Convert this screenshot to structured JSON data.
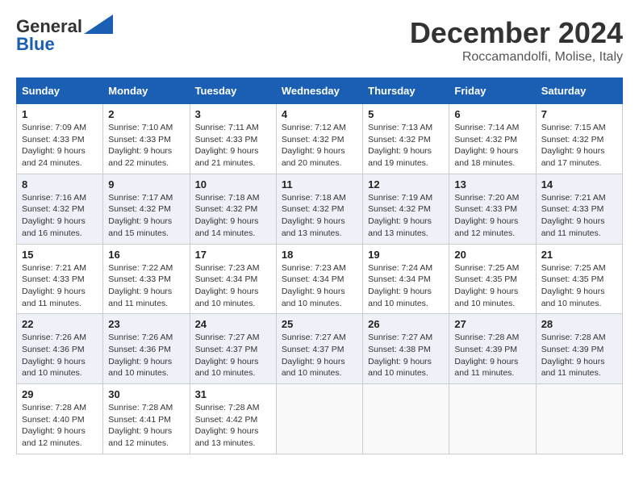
{
  "logo": {
    "line1": "General",
    "line2": "Blue"
  },
  "title": "December 2024",
  "location": "Roccamandolfi, Molise, Italy",
  "days_of_week": [
    "Sunday",
    "Monday",
    "Tuesday",
    "Wednesday",
    "Thursday",
    "Friday",
    "Saturday"
  ],
  "weeks": [
    [
      {
        "day": "1",
        "sunrise": "7:09 AM",
        "sunset": "4:33 PM",
        "daylight": "9 hours and 24 minutes."
      },
      {
        "day": "2",
        "sunrise": "7:10 AM",
        "sunset": "4:33 PM",
        "daylight": "9 hours and 22 minutes."
      },
      {
        "day": "3",
        "sunrise": "7:11 AM",
        "sunset": "4:33 PM",
        "daylight": "9 hours and 21 minutes."
      },
      {
        "day": "4",
        "sunrise": "7:12 AM",
        "sunset": "4:32 PM",
        "daylight": "9 hours and 20 minutes."
      },
      {
        "day": "5",
        "sunrise": "7:13 AM",
        "sunset": "4:32 PM",
        "daylight": "9 hours and 19 minutes."
      },
      {
        "day": "6",
        "sunrise": "7:14 AM",
        "sunset": "4:32 PM",
        "daylight": "9 hours and 18 minutes."
      },
      {
        "day": "7",
        "sunrise": "7:15 AM",
        "sunset": "4:32 PM",
        "daylight": "9 hours and 17 minutes."
      }
    ],
    [
      {
        "day": "8",
        "sunrise": "7:16 AM",
        "sunset": "4:32 PM",
        "daylight": "9 hours and 16 minutes."
      },
      {
        "day": "9",
        "sunrise": "7:17 AM",
        "sunset": "4:32 PM",
        "daylight": "9 hours and 15 minutes."
      },
      {
        "day": "10",
        "sunrise": "7:18 AM",
        "sunset": "4:32 PM",
        "daylight": "9 hours and 14 minutes."
      },
      {
        "day": "11",
        "sunrise": "7:18 AM",
        "sunset": "4:32 PM",
        "daylight": "9 hours and 13 minutes."
      },
      {
        "day": "12",
        "sunrise": "7:19 AM",
        "sunset": "4:32 PM",
        "daylight": "9 hours and 13 minutes."
      },
      {
        "day": "13",
        "sunrise": "7:20 AM",
        "sunset": "4:33 PM",
        "daylight": "9 hours and 12 minutes."
      },
      {
        "day": "14",
        "sunrise": "7:21 AM",
        "sunset": "4:33 PM",
        "daylight": "9 hours and 11 minutes."
      }
    ],
    [
      {
        "day": "15",
        "sunrise": "7:21 AM",
        "sunset": "4:33 PM",
        "daylight": "9 hours and 11 minutes."
      },
      {
        "day": "16",
        "sunrise": "7:22 AM",
        "sunset": "4:33 PM",
        "daylight": "9 hours and 11 minutes."
      },
      {
        "day": "17",
        "sunrise": "7:23 AM",
        "sunset": "4:34 PM",
        "daylight": "9 hours and 10 minutes."
      },
      {
        "day": "18",
        "sunrise": "7:23 AM",
        "sunset": "4:34 PM",
        "daylight": "9 hours and 10 minutes."
      },
      {
        "day": "19",
        "sunrise": "7:24 AM",
        "sunset": "4:34 PM",
        "daylight": "9 hours and 10 minutes."
      },
      {
        "day": "20",
        "sunrise": "7:25 AM",
        "sunset": "4:35 PM",
        "daylight": "9 hours and 10 minutes."
      },
      {
        "day": "21",
        "sunrise": "7:25 AM",
        "sunset": "4:35 PM",
        "daylight": "9 hours and 10 minutes."
      }
    ],
    [
      {
        "day": "22",
        "sunrise": "7:26 AM",
        "sunset": "4:36 PM",
        "daylight": "9 hours and 10 minutes."
      },
      {
        "day": "23",
        "sunrise": "7:26 AM",
        "sunset": "4:36 PM",
        "daylight": "9 hours and 10 minutes."
      },
      {
        "day": "24",
        "sunrise": "7:27 AM",
        "sunset": "4:37 PM",
        "daylight": "9 hours and 10 minutes."
      },
      {
        "day": "25",
        "sunrise": "7:27 AM",
        "sunset": "4:37 PM",
        "daylight": "9 hours and 10 minutes."
      },
      {
        "day": "26",
        "sunrise": "7:27 AM",
        "sunset": "4:38 PM",
        "daylight": "9 hours and 10 minutes."
      },
      {
        "day": "27",
        "sunrise": "7:28 AM",
        "sunset": "4:39 PM",
        "daylight": "9 hours and 11 minutes."
      },
      {
        "day": "28",
        "sunrise": "7:28 AM",
        "sunset": "4:39 PM",
        "daylight": "9 hours and 11 minutes."
      }
    ],
    [
      {
        "day": "29",
        "sunrise": "7:28 AM",
        "sunset": "4:40 PM",
        "daylight": "9 hours and 12 minutes."
      },
      {
        "day": "30",
        "sunrise": "7:28 AM",
        "sunset": "4:41 PM",
        "daylight": "9 hours and 12 minutes."
      },
      {
        "day": "31",
        "sunrise": "7:28 AM",
        "sunset": "4:42 PM",
        "daylight": "9 hours and 13 minutes."
      },
      null,
      null,
      null,
      null
    ]
  ],
  "labels": {
    "sunrise": "Sunrise:",
    "sunset": "Sunset:",
    "daylight": "Daylight:"
  }
}
